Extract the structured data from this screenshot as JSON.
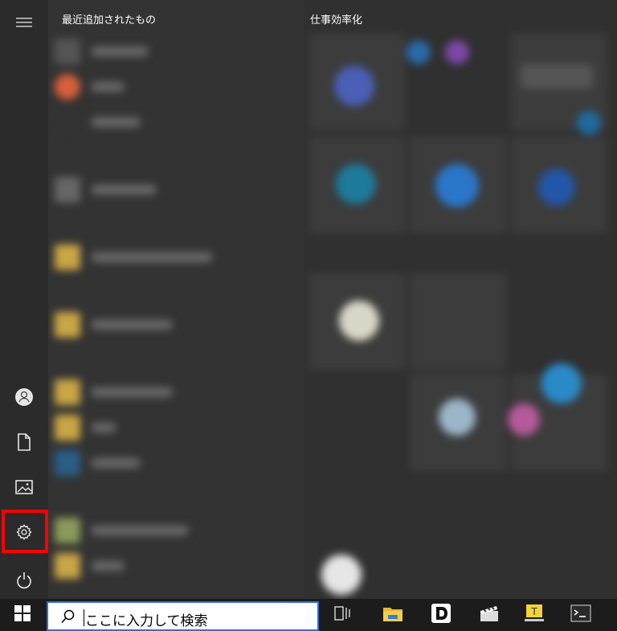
{
  "start_menu": {
    "recent_header": "最近追加されたもの",
    "tiles_header": "仕事効率化",
    "rail": [
      {
        "name": "menu-icon"
      },
      {
        "name": "user-icon"
      },
      {
        "name": "document-icon"
      },
      {
        "name": "pictures-icon"
      },
      {
        "name": "settings-icon",
        "highlighted": true
      },
      {
        "name": "power-icon"
      }
    ]
  },
  "taskbar": {
    "search_placeholder": "ここに入力して検索",
    "icons": [
      "windows-start-icon",
      "task-view-icon",
      "file-explorer-icon",
      "d-app-icon",
      "clapper-app-icon",
      "text-app-icon",
      "terminal-icon"
    ]
  },
  "colors": {
    "highlight": "#ff0000",
    "search_border": "#2d6fd6"
  }
}
